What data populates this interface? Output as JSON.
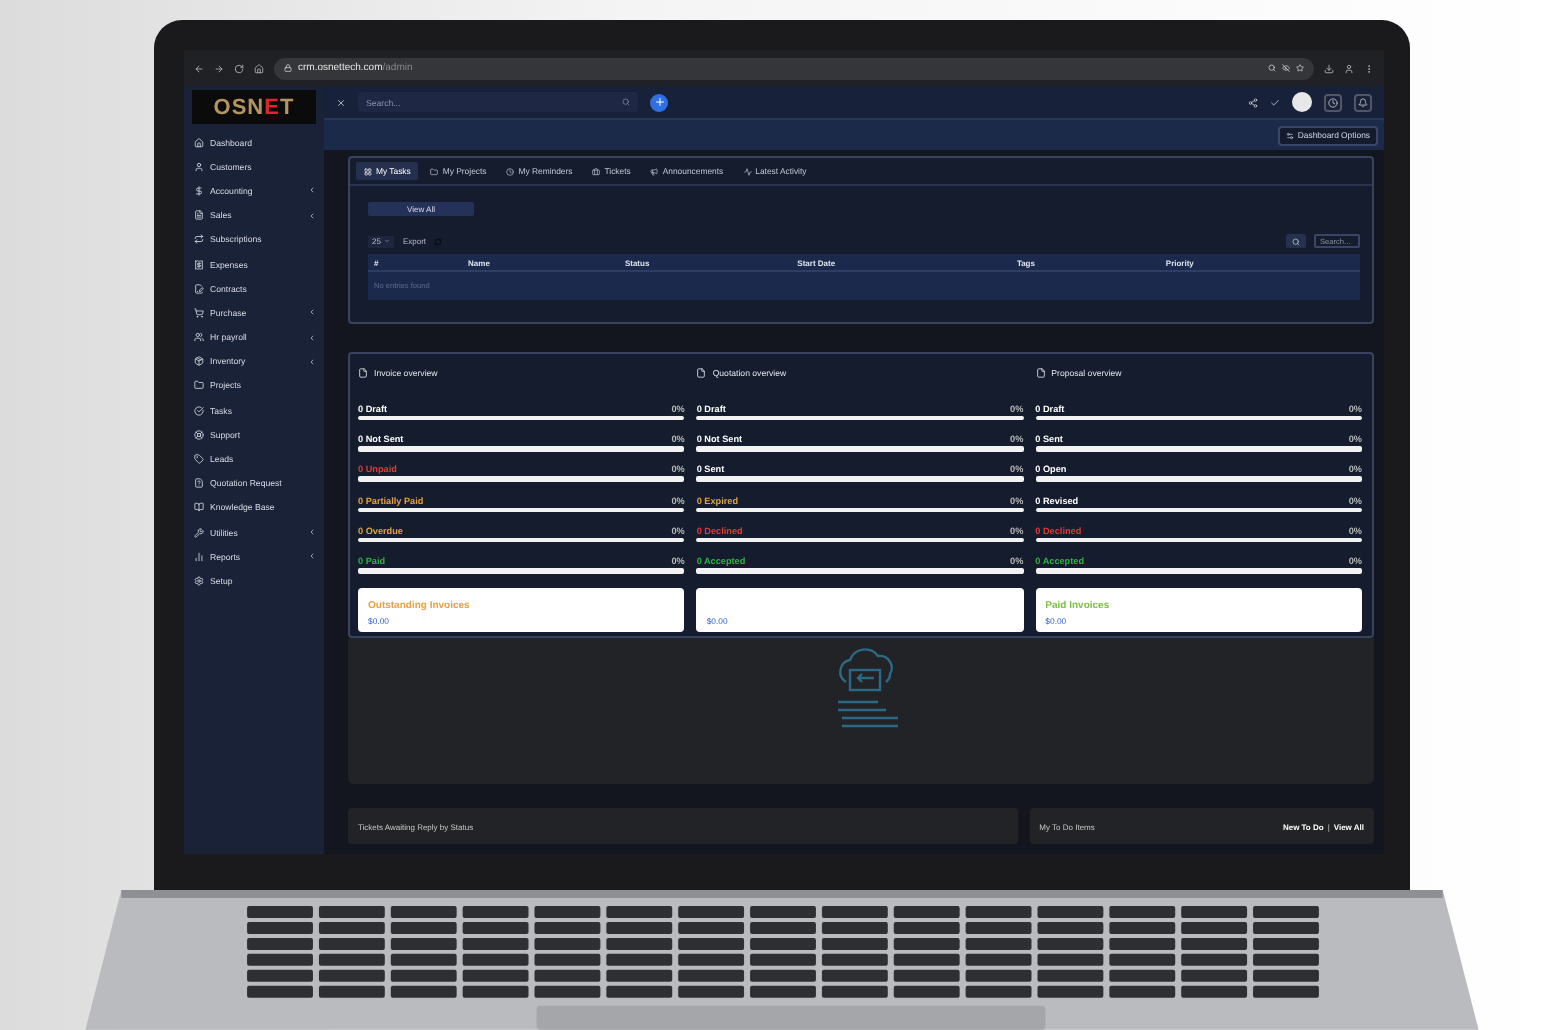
{
  "browser": {
    "url_host": "crm.osnettech.com",
    "url_path": "/admin"
  },
  "logo": {
    "lead": "OSN",
    "accent": "E",
    "tail": "T"
  },
  "sidebar": {
    "items": [
      {
        "label": "Dashboard",
        "expandable": false
      },
      {
        "label": "Customers",
        "expandable": false
      },
      {
        "label": "Accounting",
        "expandable": true
      },
      {
        "label": "Sales",
        "expandable": true
      },
      {
        "label": "Subscriptions",
        "expandable": false
      },
      {
        "label": "Expenses",
        "expandable": false
      },
      {
        "label": "Contracts",
        "expandable": false
      },
      {
        "label": "Purchase",
        "expandable": true
      },
      {
        "label": "Hr payroll",
        "expandable": true
      },
      {
        "label": "Inventory",
        "expandable": true
      },
      {
        "label": "Projects",
        "expandable": false
      },
      {
        "label": "Tasks",
        "expandable": false
      },
      {
        "label": "Support",
        "expandable": false
      },
      {
        "label": "Leads",
        "expandable": false
      },
      {
        "label": "Quotation Request",
        "expandable": false
      },
      {
        "label": "Knowledge Base",
        "expandable": false
      },
      {
        "label": "Utilities",
        "expandable": true
      },
      {
        "label": "Reports",
        "expandable": true
      },
      {
        "label": "Setup",
        "expandable": false
      }
    ]
  },
  "header": {
    "search": {
      "placeholder": "Search..."
    }
  },
  "dashboard_options": "Dashboard Options",
  "tasks_panel": {
    "tabs": [
      {
        "label": "My Tasks",
        "selected": true
      },
      {
        "label": "My Projects",
        "selected": false
      },
      {
        "label": "My Reminders",
        "selected": false
      },
      {
        "label": "Tickets",
        "selected": false
      },
      {
        "label": "Announcements",
        "selected": false
      },
      {
        "label": "Latest Activity",
        "selected": false
      }
    ],
    "view_all": "View All",
    "page_size": "25",
    "export": "Export",
    "search": {
      "placeholder": "Search..."
    },
    "columns": [
      "#",
      "Name",
      "Status",
      "Start Date",
      "Tags",
      "Priority"
    ],
    "empty": "No entries found"
  },
  "overviews": [
    {
      "title": "Invoice overview",
      "statuses": [
        {
          "label": "0 Draft",
          "percent": "0%",
          "level": 0,
          "color": "#ffffff"
        },
        {
          "label": "0 Not Sent",
          "percent": "0%",
          "level": 0,
          "color": "#ffffff"
        },
        {
          "label": "0 Unpaid",
          "percent": "0%",
          "level": 0,
          "color": "#e53935"
        },
        {
          "label": "0 Partially Paid",
          "percent": "0%",
          "level": 0,
          "color": "#e6a23c"
        },
        {
          "label": "0 Overdue",
          "percent": "0%",
          "level": 0,
          "color": "#e6a23c"
        },
        {
          "label": "0 Paid",
          "percent": "0%",
          "level": 0,
          "color": "#2fb344"
        }
      ],
      "summary": {
        "label": "Outstanding Invoices",
        "color": "#e6a23c",
        "value": "$0.00"
      }
    },
    {
      "title": "Quotation overview",
      "statuses": [
        {
          "label": "0 Draft",
          "percent": "0%",
          "level": 0,
          "color": "#ffffff"
        },
        {
          "label": "0 Not Sent",
          "percent": "0%",
          "level": 0,
          "color": "#ffffff"
        },
        {
          "label": "0 Sent",
          "percent": "0%",
          "level": 0,
          "color": "#ffffff"
        },
        {
          "label": "0 Expired",
          "percent": "0%",
          "level": 0,
          "color": "#e6a23c"
        },
        {
          "label": "0 Declined",
          "percent": "0%",
          "level": 0,
          "color": "#e53935"
        },
        {
          "label": "0 Accepted",
          "percent": "0%",
          "level": 0,
          "color": "#2fb344"
        }
      ],
      "summary": {
        "value": "$0.00"
      }
    },
    {
      "title": "Proposal overview",
      "statuses": [
        {
          "label": "0 Draft",
          "percent": "0%",
          "level": 0,
          "color": "#ffffff"
        },
        {
          "label": "0 Sent",
          "percent": "0%",
          "level": 0,
          "color": "#ffffff"
        },
        {
          "label": "0 Open",
          "percent": "0%",
          "level": 0,
          "color": "#ffffff"
        },
        {
          "label": "0 Revised",
          "percent": "0%",
          "level": 0,
          "color": "#ffffff"
        },
        {
          "label": "0 Declined",
          "percent": "0%",
          "level": 0,
          "color": "#e53935"
        },
        {
          "label": "0 Accepted",
          "percent": "0%",
          "level": 0,
          "color": "#2fb344"
        }
      ],
      "summary": {
        "label": "Paid Invoices",
        "color": "#7bc043",
        "value": "$0.00"
      }
    }
  ],
  "bottom": {
    "tickets_title": "Tickets Awaiting Reply by Status",
    "todo": {
      "title": "My To Do Items",
      "new": "New To Do",
      "separator": "|",
      "view_all": "View All"
    }
  }
}
